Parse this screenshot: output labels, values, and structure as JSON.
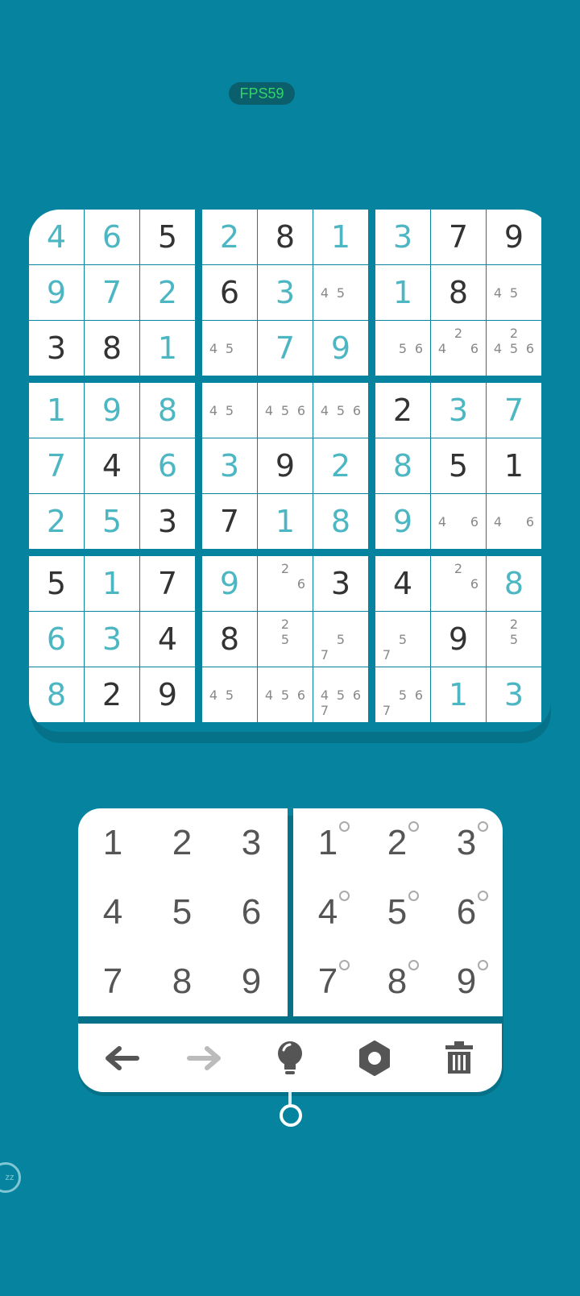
{
  "fps": "FPS59",
  "board": [
    [
      {
        "v": "4",
        "t": "e"
      },
      {
        "v": "6",
        "t": "e"
      },
      {
        "v": "5",
        "t": "g"
      },
      {
        "v": "2",
        "t": "e"
      },
      {
        "v": "8",
        "t": "g"
      },
      {
        "v": "1",
        "t": "e"
      },
      {
        "v": "3",
        "t": "e"
      },
      {
        "v": "7",
        "t": "g"
      },
      {
        "v": "9",
        "t": "g"
      }
    ],
    [
      {
        "v": "9",
        "t": "e"
      },
      {
        "v": "7",
        "t": "e"
      },
      {
        "v": "2",
        "t": "e"
      },
      {
        "v": "6",
        "t": "g"
      },
      {
        "v": "3",
        "t": "e"
      },
      {
        "n": [
          "",
          "",
          "",
          "4",
          "5",
          "",
          "",
          "",
          ""
        ]
      },
      {
        "v": "1",
        "t": "e"
      },
      {
        "v": "8",
        "t": "g"
      },
      {
        "n": [
          "",
          "",
          "",
          "4",
          "5",
          "",
          "",
          "",
          ""
        ]
      }
    ],
    [
      {
        "v": "3",
        "t": "g"
      },
      {
        "v": "8",
        "t": "g"
      },
      {
        "v": "1",
        "t": "e"
      },
      {
        "n": [
          "",
          "",
          "",
          "4",
          "5",
          "",
          "",
          "",
          ""
        ]
      },
      {
        "v": "7",
        "t": "e"
      },
      {
        "v": "9",
        "t": "e"
      },
      {
        "n": [
          "",
          "",
          "",
          "",
          "5",
          "6",
          "",
          "",
          ""
        ]
      },
      {
        "n": [
          "",
          "2",
          "",
          "4",
          "",
          "6",
          "",
          "",
          ""
        ]
      },
      {
        "n": [
          "",
          "2",
          "",
          "4",
          "5",
          "6",
          "",
          "",
          ""
        ]
      }
    ],
    [
      {
        "v": "1",
        "t": "e"
      },
      {
        "v": "9",
        "t": "e"
      },
      {
        "v": "8",
        "t": "e"
      },
      {
        "n": [
          "",
          "",
          "",
          "4",
          "5",
          "",
          "",
          "",
          ""
        ]
      },
      {
        "n": [
          "",
          "",
          "",
          "4",
          "5",
          "6",
          "",
          "",
          ""
        ]
      },
      {
        "n": [
          "",
          "",
          "",
          "4",
          "5",
          "6",
          "",
          "",
          ""
        ]
      },
      {
        "v": "2",
        "t": "g"
      },
      {
        "v": "3",
        "t": "e"
      },
      {
        "v": "7",
        "t": "e"
      }
    ],
    [
      {
        "v": "7",
        "t": "e"
      },
      {
        "v": "4",
        "t": "g"
      },
      {
        "v": "6",
        "t": "e"
      },
      {
        "v": "3",
        "t": "e"
      },
      {
        "v": "9",
        "t": "g"
      },
      {
        "v": "2",
        "t": "e"
      },
      {
        "v": "8",
        "t": "e"
      },
      {
        "v": "5",
        "t": "g"
      },
      {
        "v": "1",
        "t": "g"
      }
    ],
    [
      {
        "v": "2",
        "t": "e"
      },
      {
        "v": "5",
        "t": "e"
      },
      {
        "v": "3",
        "t": "g"
      },
      {
        "v": "7",
        "t": "g"
      },
      {
        "v": "1",
        "t": "e"
      },
      {
        "v": "8",
        "t": "e"
      },
      {
        "v": "9",
        "t": "e"
      },
      {
        "n": [
          "",
          "",
          "",
          "4",
          "",
          "6",
          "",
          "",
          ""
        ]
      },
      {
        "n": [
          "",
          "",
          "",
          "4",
          "",
          "6",
          "",
          "",
          ""
        ]
      }
    ],
    [
      {
        "v": "5",
        "t": "g"
      },
      {
        "v": "1",
        "t": "e"
      },
      {
        "v": "7",
        "t": "g"
      },
      {
        "v": "9",
        "t": "e"
      },
      {
        "n": [
          "",
          "2",
          "",
          "",
          "",
          "6",
          "",
          "",
          ""
        ]
      },
      {
        "v": "3",
        "t": "g"
      },
      {
        "v": "4",
        "t": "g"
      },
      {
        "n": [
          "",
          "2",
          "",
          "",
          "",
          "6",
          "",
          "",
          ""
        ]
      },
      {
        "v": "8",
        "t": "e"
      }
    ],
    [
      {
        "v": "6",
        "t": "e"
      },
      {
        "v": "3",
        "t": "e"
      },
      {
        "v": "4",
        "t": "g"
      },
      {
        "v": "8",
        "t": "g"
      },
      {
        "n": [
          "",
          "2",
          "",
          "",
          "5",
          "",
          "",
          "",
          ""
        ]
      },
      {
        "n": [
          "",
          "",
          "",
          "",
          "5",
          "",
          "7",
          "",
          ""
        ]
      },
      {
        "n": [
          "",
          "",
          "",
          "",
          "5",
          "",
          "7",
          "",
          ""
        ]
      },
      {
        "v": "9",
        "t": "g"
      },
      {
        "n": [
          "",
          "2",
          "",
          "",
          "5",
          "",
          "",
          "",
          ""
        ]
      }
    ],
    [
      {
        "v": "8",
        "t": "e"
      },
      {
        "v": "2",
        "t": "g"
      },
      {
        "v": "9",
        "t": "g"
      },
      {
        "n": [
          "",
          "",
          "",
          "4",
          "5",
          "",
          "",
          "",
          ""
        ]
      },
      {
        "n": [
          "",
          "",
          "",
          "4",
          "5",
          "6",
          "",
          "",
          ""
        ]
      },
      {
        "n": [
          "",
          "",
          "",
          "4",
          "5",
          "6",
          "7",
          "",
          ""
        ]
      },
      {
        "n": [
          "",
          "",
          "",
          "",
          "5",
          "6",
          "7",
          "",
          ""
        ]
      },
      {
        "v": "1",
        "t": "e"
      },
      {
        "v": "3",
        "t": "e"
      }
    ]
  ],
  "keypad": {
    "numbers": [
      "1",
      "2",
      "3",
      "4",
      "5",
      "6",
      "7",
      "8",
      "9"
    ],
    "note_numbers": [
      "1",
      "2",
      "3",
      "4",
      "5",
      "6",
      "7",
      "8",
      "9"
    ]
  },
  "toolbar": {
    "icons": [
      "undo-arrow-icon",
      "redo-arrow-icon",
      "hint-bulb-icon",
      "settings-gear-icon",
      "trash-icon"
    ],
    "colors": {
      "active": "#555555",
      "disabled": "#bbbbbb"
    }
  },
  "colors": {
    "background": "#06849f",
    "entered": "#4cb7c3",
    "given": "#333333",
    "notes": "#888888"
  }
}
